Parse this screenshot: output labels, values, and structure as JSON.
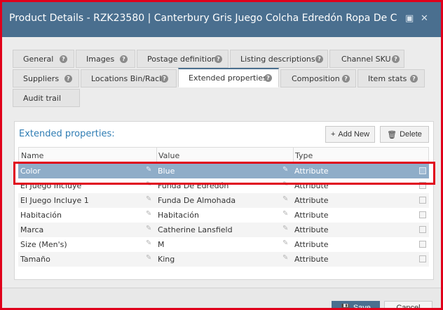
{
  "window": {
    "title": "Product Details - RZK23580 | Canterbury Gris Juego Colcha Edredón Ropa De C...",
    "maximize_icon": "maximize-icon",
    "close_icon": "close-icon"
  },
  "tabs": [
    {
      "label": "General"
    },
    {
      "label": "Images"
    },
    {
      "label": "Postage definition"
    },
    {
      "label": "Listing descriptions"
    },
    {
      "label": "Channel SKU"
    },
    {
      "label": "Suppliers"
    },
    {
      "label": "Locations Bin/Rack"
    },
    {
      "label": "Extended properties",
      "active": true
    },
    {
      "label": "Composition"
    },
    {
      "label": "Item stats"
    },
    {
      "label": "Audit trail"
    }
  ],
  "panel": {
    "title": "Extended properties:",
    "add_label": "Add New",
    "delete_label": "Delete"
  },
  "grid": {
    "columns": [
      "Name",
      "Value",
      "Type"
    ],
    "rows": [
      {
        "name": "Color",
        "value": "Blue",
        "type": "Attribute",
        "selected": true
      },
      {
        "name": "El Juego Incluye",
        "value": "Funda De Edredón",
        "type": "Attribute"
      },
      {
        "name": "El Juego Incluye 1",
        "value": "Funda De Almohada",
        "type": "Attribute"
      },
      {
        "name": "Habitación",
        "value": "Habitación",
        "type": "Attribute"
      },
      {
        "name": "Marca",
        "value": "Catherine Lansfield",
        "type": "Attribute"
      },
      {
        "name": "Size (Men's)",
        "value": "M",
        "type": "Attribute"
      },
      {
        "name": "Tamaño",
        "value": "King",
        "type": "Attribute"
      }
    ]
  },
  "footer": {
    "save_label": "Save",
    "cancel_label": "Cancel"
  },
  "colors": {
    "titlebar": "#4a6f8f",
    "selected_row": "#8fadc8",
    "highlight": "#e0001b",
    "panel_title": "#2e7cb3"
  }
}
